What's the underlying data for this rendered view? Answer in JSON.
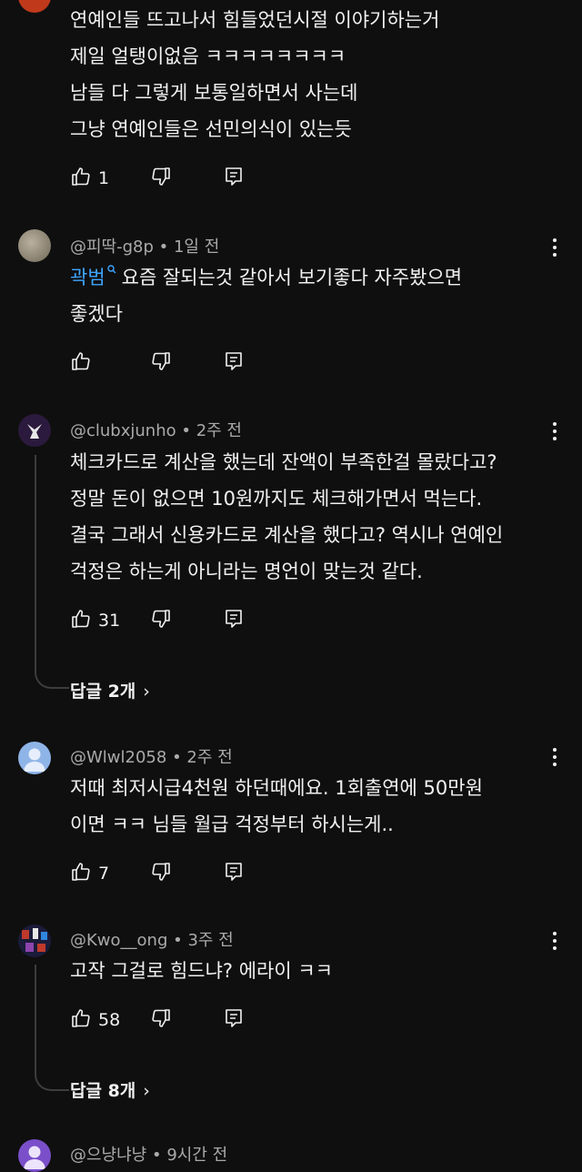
{
  "comments": [
    {
      "author": "",
      "time": "",
      "lines": [
        "연예인들 뜨고나서 힘들었던시절 이야기하는거",
        "제일 얼탱이없음 ㅋㅋㅋㅋㅋㅋㅋㅋ",
        "남들 다 그렇게 보통일하면서 사는데",
        "그냥 연예인들은 선민의식이 있는듯"
      ],
      "likes": "1",
      "avatar_color": "#c0391b"
    },
    {
      "author": "@피딱-g8p",
      "time": "1일 전",
      "mention": "곽범",
      "lines": [
        "요즘 잘되는것 같아서 보기좋다 자주봤으면",
        "좋겠다"
      ],
      "likes": "",
      "avatar_color": "#8a8170"
    },
    {
      "author": "@clubxjunho",
      "time": "2주 전",
      "lines": [
        "체크카드로 계산을 했는데 잔액이 부족한걸 몰랐다고?",
        "정말  돈이 없으면 10원까지도 체크해가면서 먹는다.",
        "결국 그래서 신용카드로 계산을 했다고? 역시나 연예인",
        "걱정은 하는게 아니라는 명언이 맞는것 같다."
      ],
      "likes": "31",
      "replies": "답글 2개",
      "avatar_color": "#2b1a3d"
    },
    {
      "author": "@Wlwl2058",
      "time": "2주 전",
      "lines": [
        "저때 최저시급4천원 하던때에요.  1회출연에 50만원",
        "이면 ㅋㅋ 님들 월급 걱정부터 하시는게.."
      ],
      "likes": "7",
      "avatar_color": "#8fb4e8"
    },
    {
      "author": "@Kwo__ong",
      "time": "3주 전",
      "lines": [
        "고작 그걸로 힘드냐? 에라이 ㅋㅋ"
      ],
      "likes": "58",
      "replies": "답글 8개",
      "avatar_color": "#1b1b3a"
    },
    {
      "author": "@으냥냐냥",
      "time": "9시간 전",
      "lines": [],
      "likes": "",
      "avatar_color": "#7b4fc9"
    }
  ],
  "separator": " • ",
  "icons": {
    "like": "thumbs-up-icon",
    "dislike": "thumbs-down-icon",
    "reply": "reply-comment-icon",
    "menu": "more-vertical-icon",
    "chevron": "chevron-right-icon"
  },
  "chevron_glyph": "›"
}
